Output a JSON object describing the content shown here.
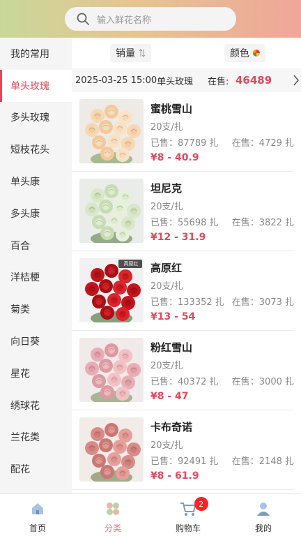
{
  "search": {
    "placeholder": "输入鲜花名称"
  },
  "sidebar": {
    "items": [
      {
        "label": "我的常用",
        "active": false
      },
      {
        "label": "单头玫瑰",
        "active": true
      },
      {
        "label": "多头玫瑰",
        "active": false
      },
      {
        "label": "短枝花头",
        "active": false
      },
      {
        "label": "单头康",
        "active": false
      },
      {
        "label": "多头康",
        "active": false
      },
      {
        "label": "百合",
        "active": false
      },
      {
        "label": "洋桔梗",
        "active": false
      },
      {
        "label": "菊类",
        "active": false
      },
      {
        "label": "向日葵",
        "active": false
      },
      {
        "label": "星花",
        "active": false
      },
      {
        "label": "绣球花",
        "active": false
      },
      {
        "label": "兰花类",
        "active": false
      },
      {
        "label": "配花",
        "active": false
      }
    ]
  },
  "sort": {
    "sales_label": "销量",
    "color_label": "颜色"
  },
  "info": {
    "datetime": "2025-03-25 15:00",
    "category": "单头玫瑰",
    "onsale_label": "在售:",
    "onsale_count": "46489"
  },
  "products": [
    {
      "name": "蜜桃雪山",
      "spec": "20支/扎",
      "sold": "已售：87789 扎",
      "stock": "在售：4729 扎",
      "price": "¥8 - 40.9",
      "color": "peach"
    },
    {
      "name": "坦尼克",
      "spec": "20支/扎",
      "sold": "已售：55698 扎",
      "stock": "在售：3822 扎",
      "price": "¥12 - 31.9",
      "color": "white"
    },
    {
      "name": "高原红",
      "spec": "20支/扎",
      "sold": "已售：133352 扎",
      "stock": "在售：3073 扎",
      "price": "¥13 - 54",
      "color": "red",
      "tag": "高原红"
    },
    {
      "name": "粉红雪山",
      "spec": "20支/扎",
      "sold": "已售：40372 扎",
      "stock": "在售：3000 扎",
      "price": "¥8 - 47",
      "color": "pink"
    },
    {
      "name": "卡布奇诺",
      "spec": "20支/扎",
      "sold": "已售：92491 扎",
      "stock": "在售：2148 扎",
      "price": "¥8 - 61.9",
      "color": "dustypink"
    }
  ],
  "tabs": [
    {
      "label": "首页",
      "icon": "home-icon",
      "active": false
    },
    {
      "label": "分类",
      "icon": "category-icon",
      "active": true
    },
    {
      "label": "购物车",
      "icon": "cart-icon",
      "active": false,
      "badge": "2"
    },
    {
      "label": "我的",
      "icon": "profile-icon",
      "active": false
    }
  ],
  "colors": {
    "accent": "#e1495c",
    "tab_active": "#e87a8a"
  }
}
